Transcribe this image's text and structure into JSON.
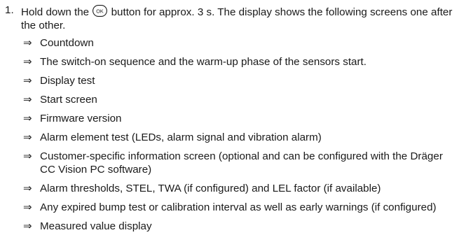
{
  "step": {
    "number": "1.",
    "text_before_icon": "Hold down the",
    "icon_name": "ok-button-icon",
    "icon_label": "OK",
    "text_after_icon": "button for approx. 3 s. The display shows the following screens one after the other."
  },
  "results": [
    {
      "text": "Countdown"
    },
    {
      "text": "The switch-on sequence and the warm-up phase of the sensors start."
    },
    {
      "text": "Display test"
    },
    {
      "text": "Start screen"
    },
    {
      "text": "Firmware version"
    },
    {
      "text": "Alarm element test (LEDs, alarm signal and vibration alarm)"
    },
    {
      "text": "Customer-specific information screen (optional and can be configured with the Dräger CC Vision PC software)"
    },
    {
      "text": "Alarm thresholds, STEL, TWA (if configured) and LEL factor (if available)"
    },
    {
      "text": "Any expired bump test or calibration interval as well as early warnings (if configured)"
    },
    {
      "text": "Measured value display"
    }
  ],
  "result_marker": "⇒"
}
